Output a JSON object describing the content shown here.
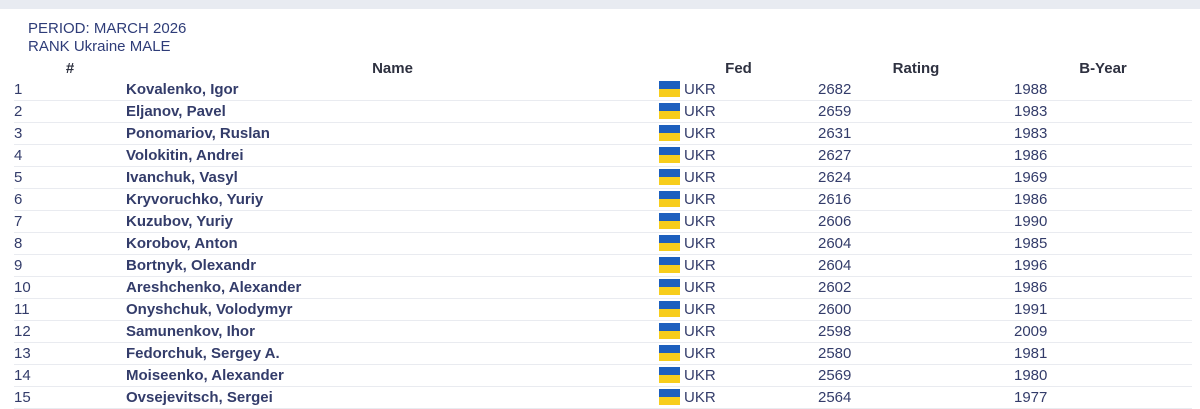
{
  "header": {
    "period": "PERIOD: MARCH 2026",
    "rank": "RANK Ukraine MALE"
  },
  "table": {
    "columns": [
      "#",
      "Name",
      "Fed",
      "Rating",
      "B-Year"
    ],
    "rows": [
      {
        "rank": "1",
        "name": "Kovalenko, Igor",
        "fed": "UKR",
        "rating": "2682",
        "byear": "1988"
      },
      {
        "rank": "2",
        "name": "Eljanov, Pavel",
        "fed": "UKR",
        "rating": "2659",
        "byear": "1983"
      },
      {
        "rank": "3",
        "name": "Ponomariov, Ruslan",
        "fed": "UKR",
        "rating": "2631",
        "byear": "1983"
      },
      {
        "rank": "4",
        "name": "Volokitin, Andrei",
        "fed": "UKR",
        "rating": "2627",
        "byear": "1986"
      },
      {
        "rank": "5",
        "name": "Ivanchuk, Vasyl",
        "fed": "UKR",
        "rating": "2624",
        "byear": "1969"
      },
      {
        "rank": "6",
        "name": "Kryvoruchko, Yuriy",
        "fed": "UKR",
        "rating": "2616",
        "byear": "1986"
      },
      {
        "rank": "7",
        "name": "Kuzubov, Yuriy",
        "fed": "UKR",
        "rating": "2606",
        "byear": "1990"
      },
      {
        "rank": "8",
        "name": "Korobov, Anton",
        "fed": "UKR",
        "rating": "2604",
        "byear": "1985"
      },
      {
        "rank": "9",
        "name": "Bortnyk, Olexandr",
        "fed": "UKR",
        "rating": "2604",
        "byear": "1996"
      },
      {
        "rank": "10",
        "name": "Areshchenko, Alexander",
        "fed": "UKR",
        "rating": "2602",
        "byear": "1986"
      },
      {
        "rank": "11",
        "name": "Onyshchuk, Volodymyr",
        "fed": "UKR",
        "rating": "2600",
        "byear": "1991"
      },
      {
        "rank": "12",
        "name": "Samunenkov, Ihor",
        "fed": "UKR",
        "rating": "2598",
        "byear": "2009"
      },
      {
        "rank": "13",
        "name": "Fedorchuk, Sergey A.",
        "fed": "UKR",
        "rating": "2580",
        "byear": "1981"
      },
      {
        "rank": "14",
        "name": "Moiseenko, Alexander",
        "fed": "UKR",
        "rating": "2569",
        "byear": "1980"
      },
      {
        "rank": "15",
        "name": "Ovsejevitsch, Sergei",
        "fed": "UKR",
        "rating": "2564",
        "byear": "1977"
      }
    ]
  },
  "flag": {
    "icon": "ukraine-flag-icon",
    "top_color": "#1d5fbe",
    "bottom_color": "#f7cd1c"
  }
}
